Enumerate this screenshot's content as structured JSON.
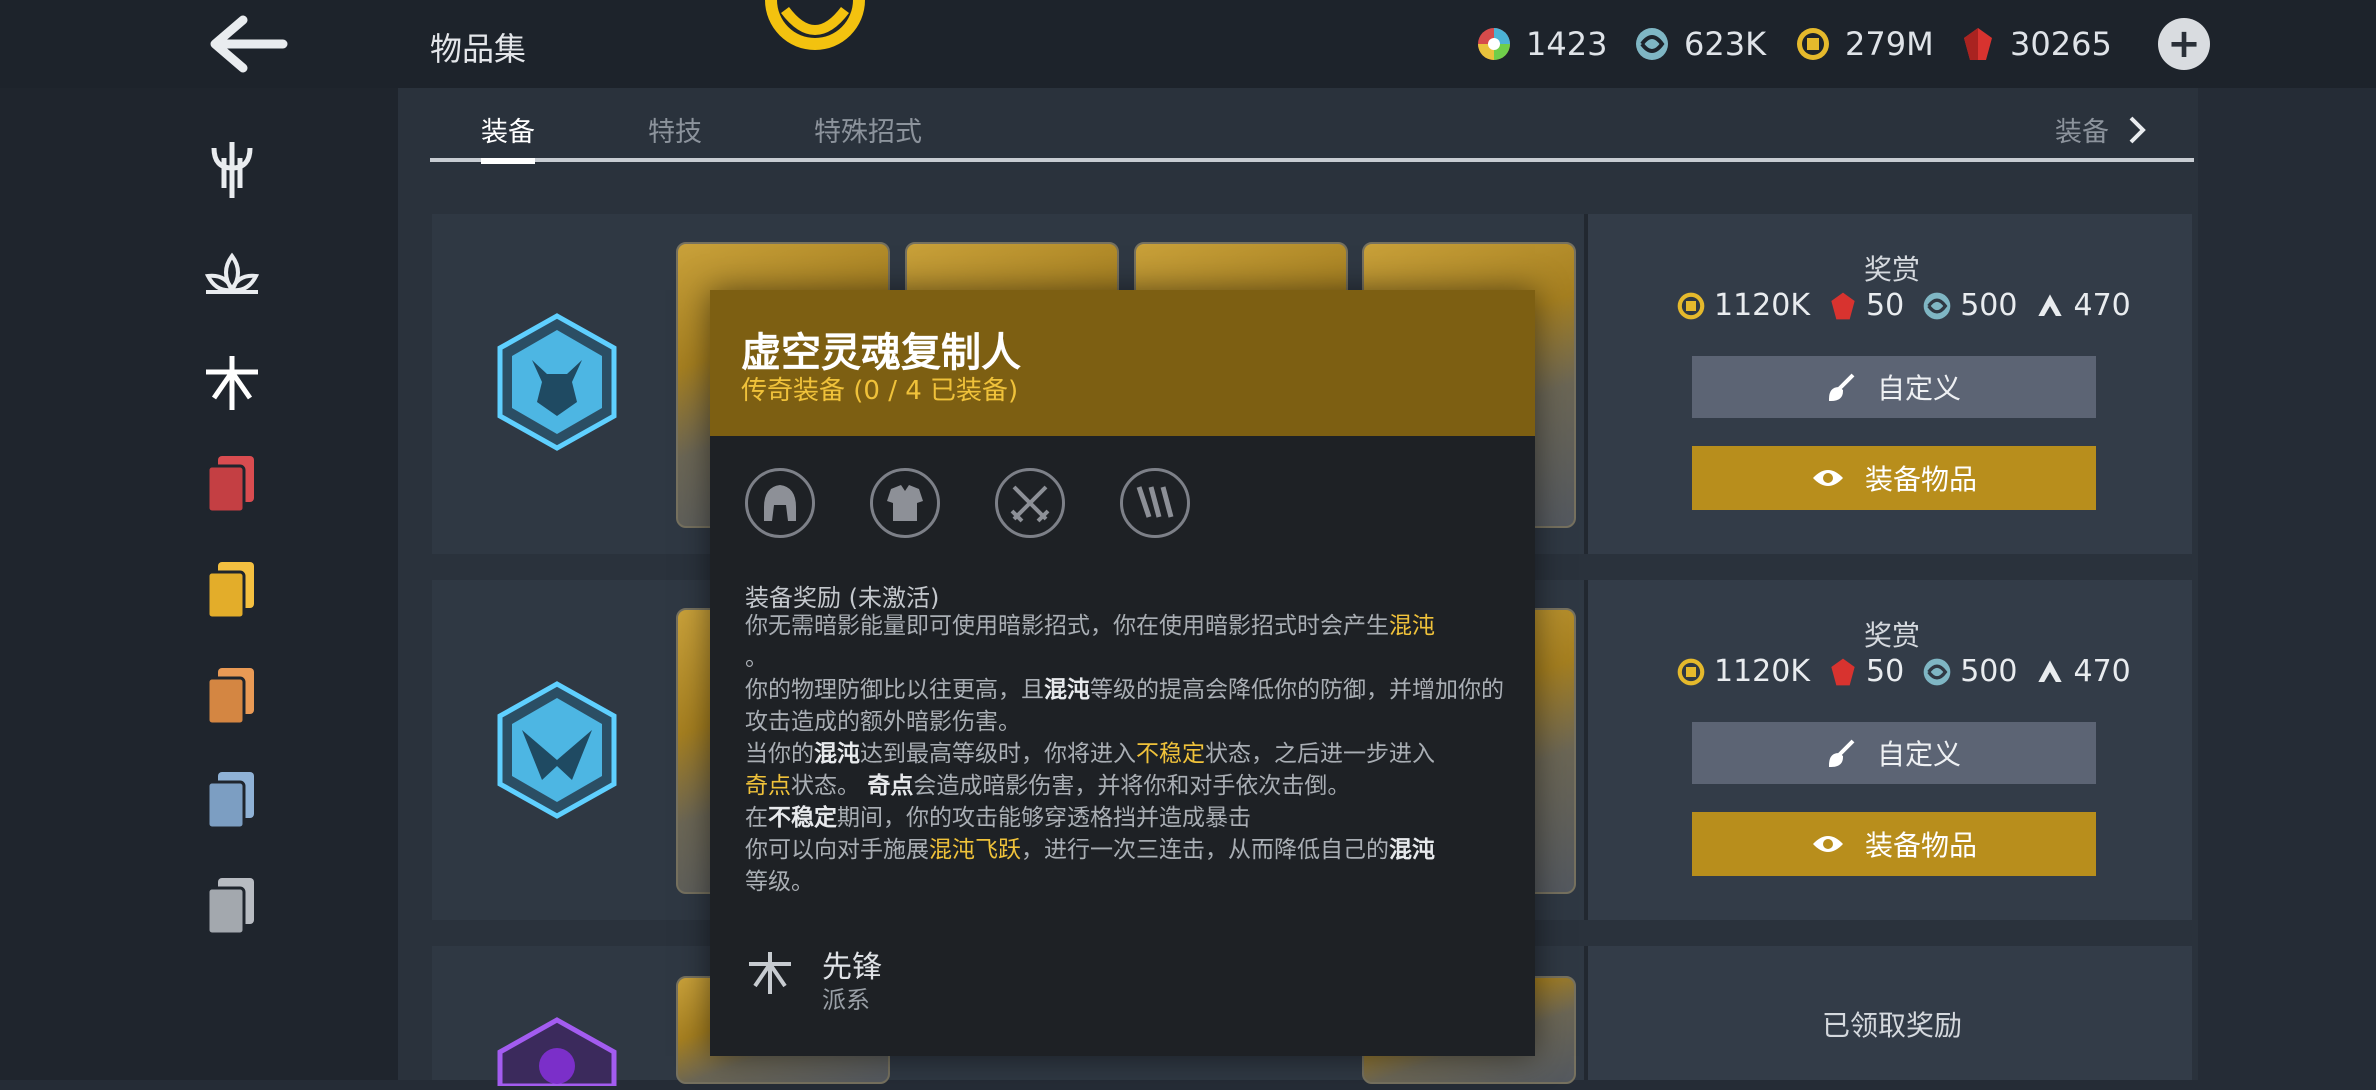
{
  "header": {
    "title": "物品集"
  },
  "currencies": [
    {
      "icon": "multicolor-orb-icon",
      "value": "1423"
    },
    {
      "icon": "spirit-swirl-icon",
      "value": "623K"
    },
    {
      "icon": "gold-coin-icon",
      "value": "279M"
    },
    {
      "icon": "ruby-gem-icon",
      "value": "30265"
    }
  ],
  "tabs": {
    "equipment": "装备",
    "skills": "特技",
    "special_moves": "特殊招式",
    "next_label": "装备"
  },
  "rows": [
    {
      "reward_label": "奖赏",
      "rewards": {
        "coins": "1120K",
        "gems": "50",
        "spirit": "500",
        "shards": "470"
      },
      "custom_label": "自定义",
      "equip_label": "装备物品"
    },
    {
      "reward_label": "奖赏",
      "rewards": {
        "coins": "1120K",
        "gems": "50",
        "spirit": "500",
        "shards": "470"
      },
      "custom_label": "自定义",
      "equip_label": "装备物品"
    },
    {
      "claimed_label": "已领取奖励"
    }
  ],
  "popup": {
    "title": "虚空灵魂复制人",
    "subtitle": "传奇装备 (0 / 4 已装备)",
    "bonus_heading": "装备奖励 (未激活)",
    "bonus": {
      "l1a": "你无需暗影能量即可使用暗影招式，你在使用暗影招式时会产生",
      "chaos": "混沌",
      "l1b": "。",
      "l2a": "你的物理防御比以往更高，且",
      "l2b": "等级的提高会降低你的防御，并增加你的攻击造成的额外暗影伤害。",
      "l3a": "当你的",
      "l3b": "达到最高等级时，你将进入",
      "unstable": "不稳定",
      "l3c": "状态，之后进一步进入",
      "oddpoint": "奇点",
      "l3d": "状态。",
      "l3e": "会造成暗影伤害，并将你和对手依次击倒。",
      "l4a": "在",
      "l4b": "期间，你的攻击能够穿透格挡并造成暴击",
      "l5a": "你可以向对手施展",
      "chaos_leap": "混沌飞跃",
      "l5b": "，进行一次三连击，从而降低自己的",
      "l5c": "等级。"
    },
    "faction_name": "先锋",
    "faction_sub": "派系"
  },
  "colors": {
    "gold_accent": "#f0c23a",
    "equip_button": "#b88e1c",
    "popup_header": "#7d5f12"
  }
}
